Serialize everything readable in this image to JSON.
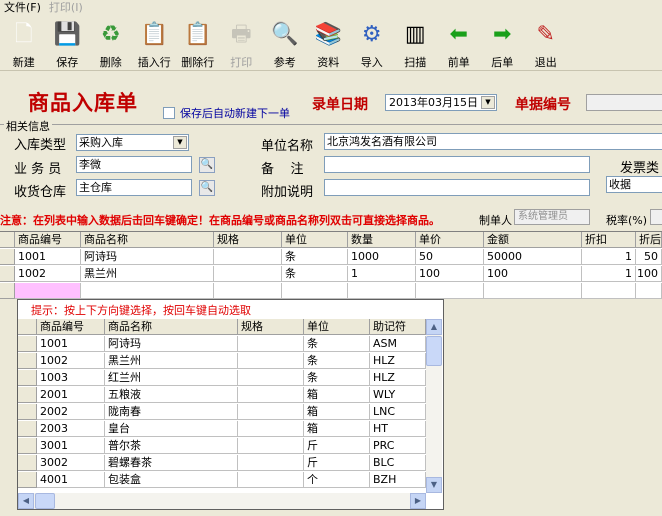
{
  "menu": {
    "file": "文件(F)",
    "print": "打印(I)"
  },
  "toolbar": [
    {
      "name": "new",
      "label": "新建",
      "icon": "new-document-icon",
      "glyph": "🗋",
      "color": "#ffffff",
      "disabled": false
    },
    {
      "name": "save",
      "label": "保存",
      "icon": "floppy-disk-icon",
      "glyph": "💾",
      "color": "#404040",
      "disabled": false
    },
    {
      "name": "delete",
      "label": "删除",
      "icon": "recycle-bin-icon",
      "glyph": "♻",
      "color": "#3a9a3a",
      "disabled": false
    },
    {
      "name": "insert-row",
      "label": "插入行",
      "icon": "insert-row-icon",
      "glyph": "📋",
      "color": "#505050",
      "disabled": false
    },
    {
      "name": "delete-row",
      "label": "删除行",
      "icon": "delete-row-icon",
      "glyph": "📋",
      "color": "#505050",
      "disabled": false
    },
    {
      "name": "print",
      "label": "打印",
      "icon": "printer-icon",
      "glyph": "🖶",
      "color": "#808080",
      "disabled": true
    },
    {
      "name": "reference",
      "label": "参考",
      "icon": "magnifier-icon",
      "glyph": "🔍",
      "color": "#606060",
      "disabled": false
    },
    {
      "name": "data",
      "label": "资料",
      "icon": "book-icon",
      "glyph": "📚",
      "color": "#2050a0",
      "disabled": false
    },
    {
      "name": "import",
      "label": "导入",
      "icon": "gear-icon",
      "glyph": "⚙",
      "color": "#3060c0",
      "disabled": false
    },
    {
      "name": "scan",
      "label": "扫描",
      "icon": "barcode-icon",
      "glyph": "▥",
      "color": "#000000",
      "disabled": false
    },
    {
      "name": "prev",
      "label": "前单",
      "icon": "arrow-left-icon",
      "glyph": "⬅",
      "color": "#1aa01a",
      "disabled": false
    },
    {
      "name": "next",
      "label": "后单",
      "icon": "arrow-right-icon",
      "glyph": "➡",
      "color": "#1aa01a",
      "disabled": false
    },
    {
      "name": "exit",
      "label": "退出",
      "icon": "exit-icon",
      "glyph": "✎",
      "color": "#c02020",
      "disabled": false
    }
  ],
  "header": {
    "title": "商品入库单",
    "auto_new_label": "保存后自动新建下一单",
    "date_label": "录单日期",
    "date_value": "2013年03月15日",
    "number_label": "单据编号",
    "number_value": ""
  },
  "form": {
    "group_title": "相关信息",
    "type_label": "入库类型",
    "type_value": "采购入库",
    "clerk_label": "业 务 员",
    "clerk_value": "李微",
    "warehouse_label": "收货仓库",
    "warehouse_value": "主仓库",
    "company_label": "单位名称",
    "company_value": "北京鸿发名酒有限公司",
    "remark_label": "备    注",
    "remark_value": "",
    "extra_label": "附加说明",
    "extra_value": "",
    "invoice_label": "发票类",
    "invoice_value": "收据"
  },
  "notice": "注意：在列表中输入数据后击回车键确定！在商品编号或商品名称列双击可直接选择商品。",
  "maker": {
    "label": "制单人",
    "value": "系统管理员"
  },
  "tax": {
    "label": "税率(%)"
  },
  "grid": {
    "columns": [
      "商品编号",
      "商品名称",
      "规格",
      "单位",
      "数量",
      "单价",
      "金额",
      "折扣",
      "折后"
    ],
    "rows": [
      [
        "1001",
        "阿诗玛",
        "",
        "条",
        "1000",
        "50",
        "50000",
        "1",
        "50"
      ],
      [
        "1002",
        "黑兰州",
        "",
        "条",
        "1",
        "100",
        "100",
        "1",
        "100"
      ]
    ]
  },
  "popup": {
    "hint": "提示：按上下方向键选择，按回车键自动选取",
    "columns": [
      "商品编号",
      "商品名称",
      "规格",
      "单位",
      "助记符"
    ],
    "rows": [
      [
        "1001",
        "阿诗玛",
        "",
        "条",
        "ASM"
      ],
      [
        "1002",
        "黑兰州",
        "",
        "条",
        "HLZ"
      ],
      [
        "1003",
        "红兰州",
        "",
        "条",
        "HLZ"
      ],
      [
        "2001",
        "五粮液",
        "",
        "箱",
        "WLY"
      ],
      [
        "2002",
        "陇南春",
        "",
        "箱",
        "LNC"
      ],
      [
        "2003",
        "皇台",
        "",
        "箱",
        "HT"
      ],
      [
        "3001",
        "普尔茶",
        "",
        "斤",
        "PRC"
      ],
      [
        "3002",
        "碧螺春茶",
        "",
        "斤",
        "BLC"
      ],
      [
        "4001",
        "包装盒",
        "",
        "个",
        "BZH"
      ]
    ]
  }
}
